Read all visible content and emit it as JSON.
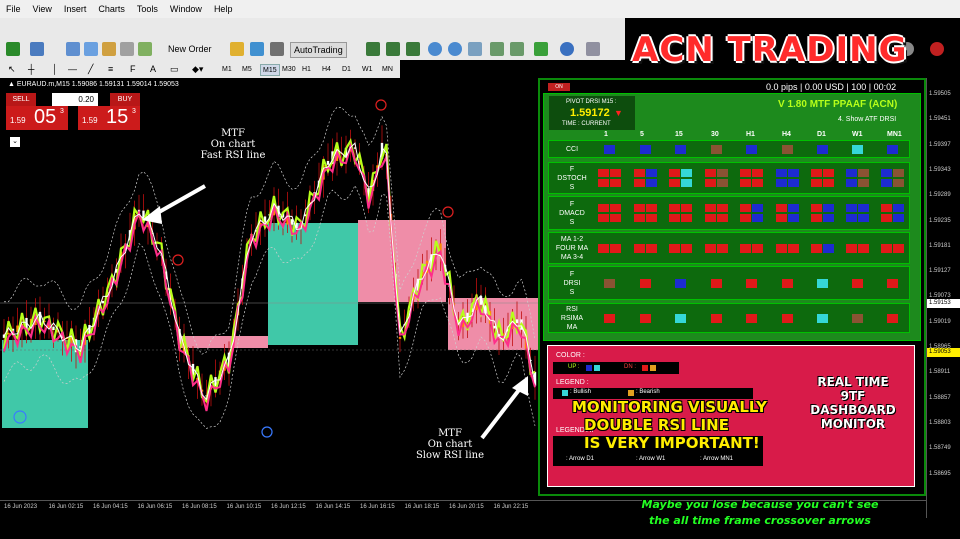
{
  "menu": [
    "File",
    "View",
    "Insert",
    "Charts",
    "Tools",
    "Window",
    "Help"
  ],
  "toolbar": {
    "new_order": "New Order",
    "autotrading": "AutoTrading"
  },
  "timeframes": [
    "M1",
    "M5",
    "M15",
    "M30",
    "H1",
    "H4",
    "D1",
    "W1",
    "MN"
  ],
  "active_timeframe": "M15",
  "logo": "ACN TRADING",
  "symbol_line": "▲ EURAUD.m,M15  1.59086 1.59131 1.59014 1.59053",
  "order": {
    "sell": "SELL",
    "buy": "BUY",
    "lot": "0.20",
    "sell_small": "1.59",
    "sell_big": "05",
    "sell_sup": "3",
    "buy_small": "1.59",
    "buy_big": "15",
    "buy_sup": "3"
  },
  "dashboard": {
    "tag": "ON",
    "header": "0.0 pips | 0.00 USD | 100 | 00:02",
    "pivot_label": "PIVOT DRSI M15 :",
    "pivot_value": "1.59172",
    "pivot_arrow": "▼",
    "time_label": "TIME : CURRENT",
    "version": "V 1.80 MTF PPAAF (ACN)",
    "show": "4. Show ATF DRSI",
    "tf_headers": [
      "1",
      "5",
      "15",
      "30",
      "H1",
      "H4",
      "D1",
      "W1",
      "MN1"
    ],
    "rows": [
      {
        "label": "CCI"
      },
      {
        "label": "F\nDSTOCH\nS"
      },
      {
        "label": "F\nDMACD\nS"
      },
      {
        "label": "MA 1-2\nFOUR MA\nMA 3-4"
      },
      {
        "label": "F\nDRSI\nS"
      },
      {
        "label": "RSI\nRSIMA\nMA"
      }
    ],
    "color_label": "COLOR :",
    "up": "UP :",
    "dn": "DN :",
    "legend": "LEGEND :",
    "bullish": ": Bullish",
    "bearish": ": Bearish",
    "legend_at": "LEGEND AT",
    "arrows": [
      ": Arrow D1",
      ": Arrow W1",
      ": Arrow MN1"
    ]
  },
  "overlay": {
    "monitor1": "MONITORING VISUALLY",
    "monitor2": "DOUBLE RSI LINE",
    "monitor3": "IS VERY IMPORTANT!",
    "realtime": "REAL TIME\n9TF\nDASHBOARD\nMONITOR",
    "bottom1": "Maybe you lose because you can't see",
    "bottom2": "the all time frame crossover arrows"
  },
  "annotations": {
    "fast": "MTF\nOn chart\nFast RSI line",
    "slow": "MTF\nOn chart\nSlow RSI line"
  },
  "prices": [
    "1.59505",
    "1.59451",
    "1.59397",
    "1.59343",
    "1.59289",
    "1.59235",
    "1.59181",
    "1.59127",
    "1.59073",
    "1.59019",
    "1.58965",
    "1.58911",
    "1.58857",
    "1.58803",
    "1.58749",
    "1.58695"
  ],
  "price_labels": {
    "current": "1.59153",
    "bid": "1.59053"
  },
  "times": [
    "16 Jun 2023",
    "16 Jun 02:15",
    "16 Jun 04:15",
    "16 Jun 06:15",
    "16 Jun 08:15",
    "16 Jun 10:15",
    "16 Jun 12:15",
    "16 Jun 14:15",
    "16 Jun 16:15",
    "16 Jun 18:15",
    "16 Jun 20:15",
    "16 Jun 22:15"
  ],
  "colors": {
    "red": "#e01919",
    "blue": "#1d2bd0",
    "green": "#1d8a1d",
    "pink": "#d81b49",
    "yellow": "#ffee00"
  }
}
